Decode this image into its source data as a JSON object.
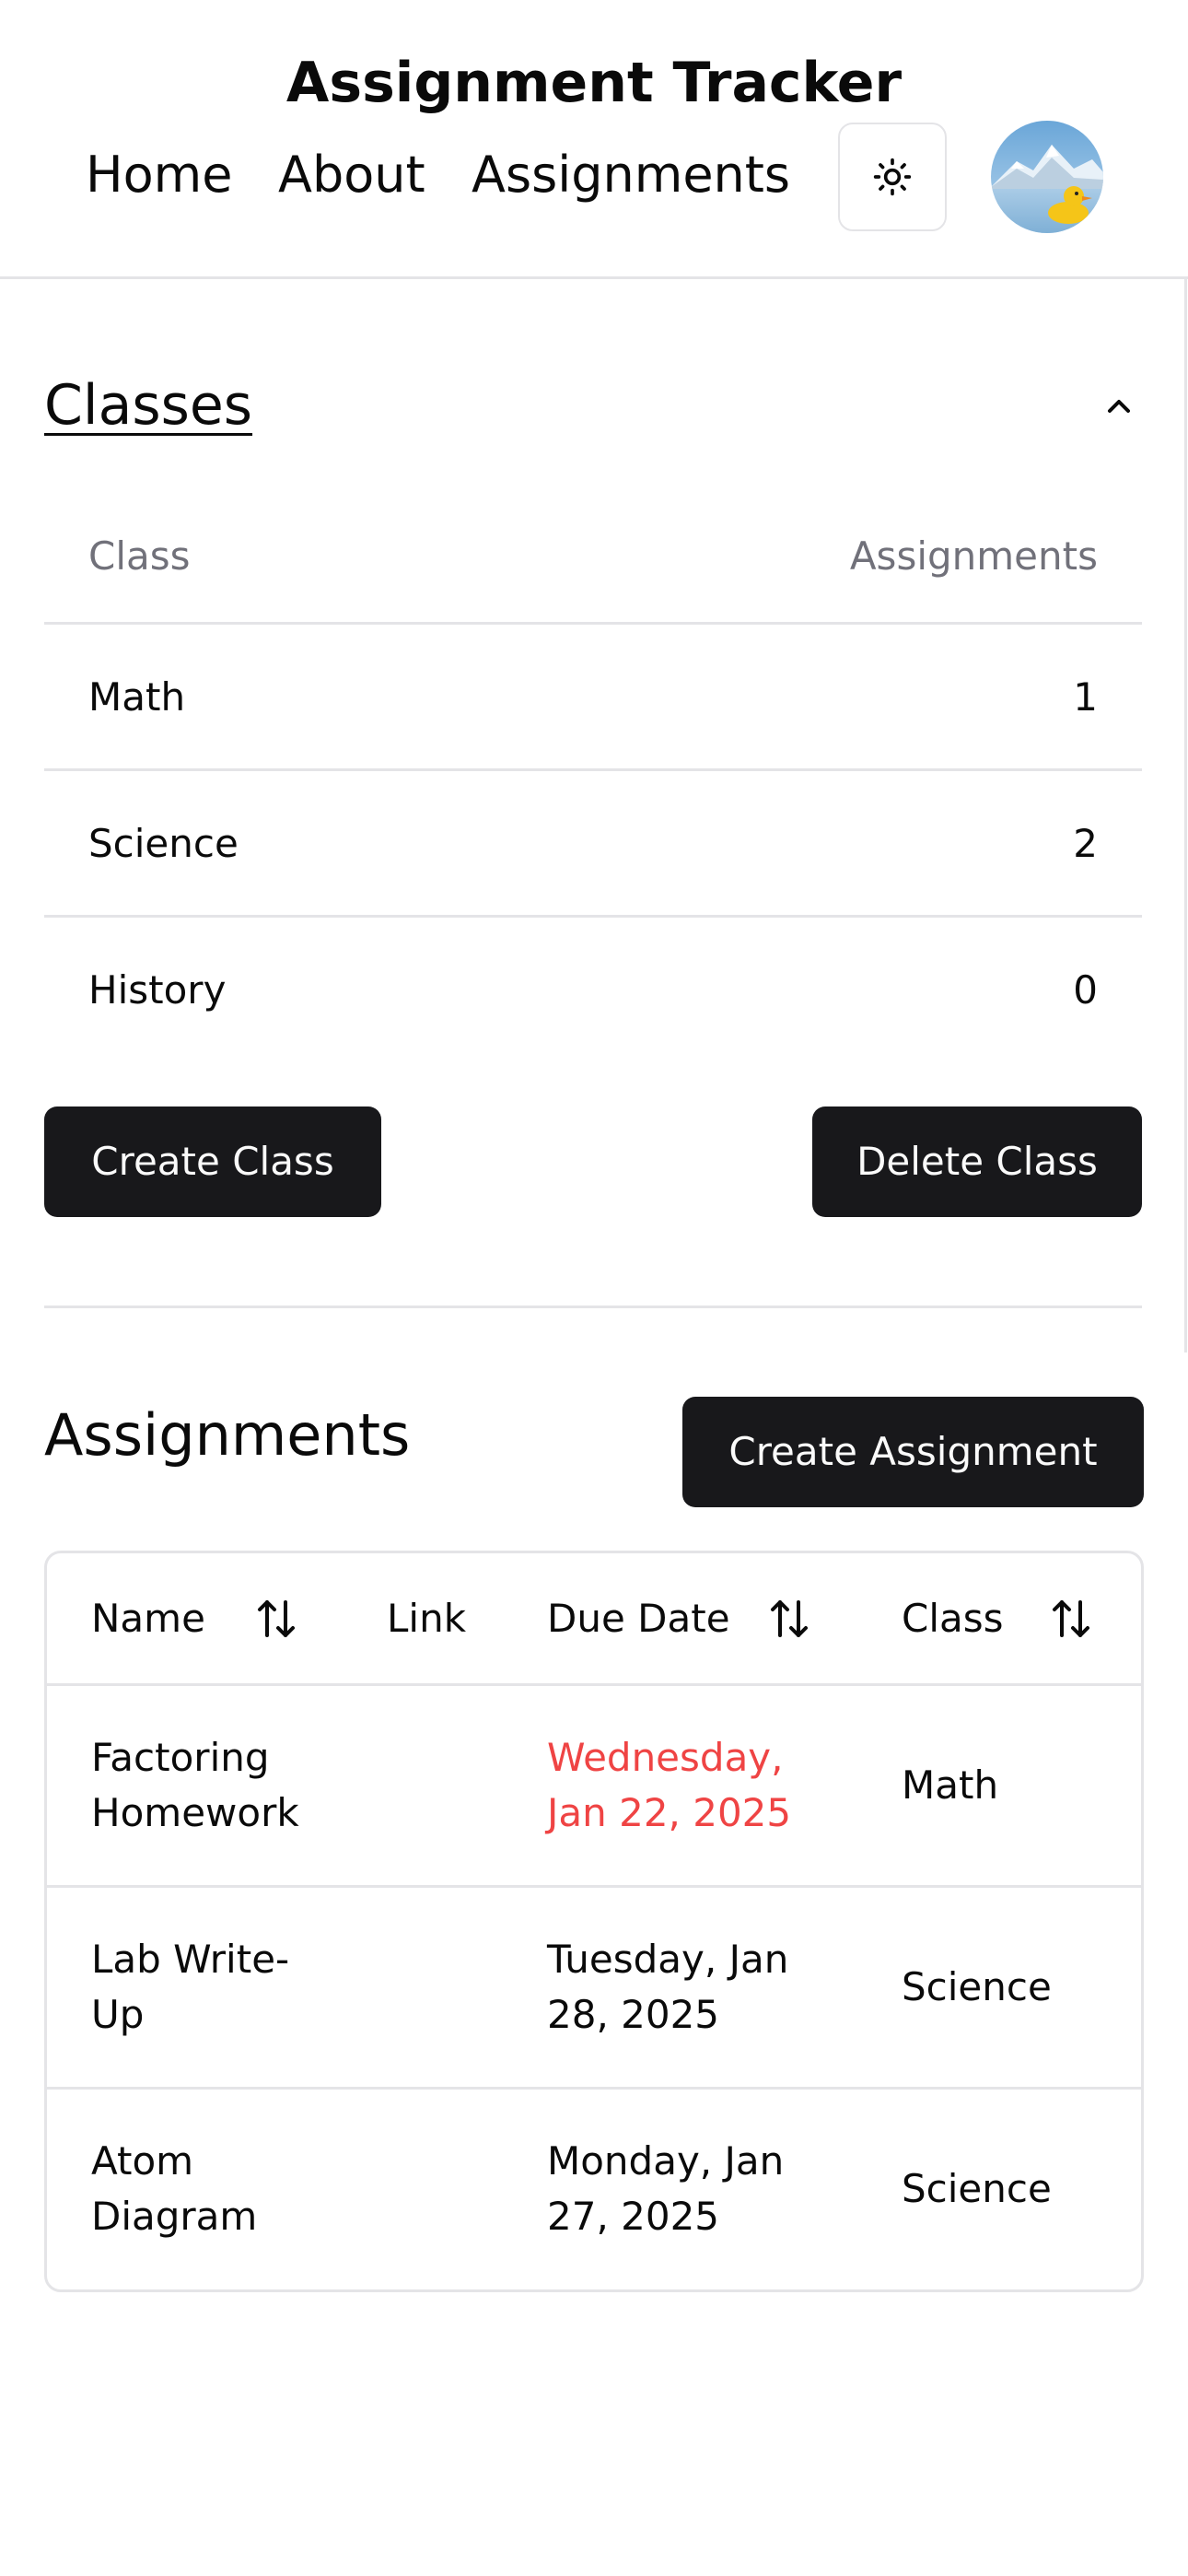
{
  "app": {
    "title": "Assignment Tracker"
  },
  "nav": {
    "items": [
      {
        "label": "Home"
      },
      {
        "label": "About"
      },
      {
        "label": "Assignments"
      }
    ],
    "theme_toggle_icon": "sun-icon",
    "avatar_icon": "user-avatar"
  },
  "classes": {
    "title": "Classes",
    "collapse_icon": "chevron-up-icon",
    "headers": {
      "class": "Class",
      "assignments": "Assignments"
    },
    "rows": [
      {
        "name": "Math",
        "count": "1"
      },
      {
        "name": "Science",
        "count": "2"
      },
      {
        "name": "History",
        "count": "0"
      }
    ],
    "create_label": "Create Class",
    "delete_label": "Delete Class"
  },
  "assignments": {
    "title": "Assignments",
    "create_label": "Create Assignment",
    "headers": {
      "name": "Name",
      "link": "Link",
      "due": "Due Date",
      "class": "Class"
    },
    "sort_icon": "arrow-up-down-icon",
    "rows": [
      {
        "name_line1": "Factoring",
        "name_line2": "Homework",
        "link": "",
        "due_line1": "Wednesday,",
        "due_line2": "Jan 22, 2025",
        "class": "Math",
        "overdue": true
      },
      {
        "name_line1": "Lab Write-",
        "name_line2": "Up",
        "link": "",
        "due_line1": "Tuesday, Jan",
        "due_line2": "28, 2025",
        "class": "Science",
        "overdue": false
      },
      {
        "name_line1": "Atom",
        "name_line2": "Diagram",
        "link": "",
        "due_line1": "Monday, Jan",
        "due_line2": "27, 2025",
        "class": "Science",
        "overdue": false
      }
    ]
  },
  "colors": {
    "primary_button": "#18181b",
    "border": "#e4e4e7",
    "muted_text": "#71717a",
    "overdue": "#ef4444"
  }
}
